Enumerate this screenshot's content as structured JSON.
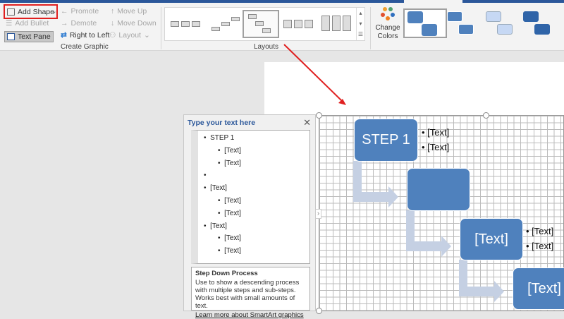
{
  "ribbon": {
    "add_shape": "Add Shape",
    "add_bullet": "Add Bullet",
    "text_pane": "Text Pane",
    "promote": "Promote",
    "demote": "Demote",
    "right_to_left": "Right to Left",
    "move_up": "Move Up",
    "move_down": "Move Down",
    "layout": "Layout",
    "group_create": "Create Graphic",
    "group_layouts": "Layouts",
    "change_colors": "Change Colors"
  },
  "text_pane": {
    "title": "Type your text here",
    "items": [
      {
        "level": 1,
        "text": "STEP 1"
      },
      {
        "level": 2,
        "text": "[Text]"
      },
      {
        "level": 2,
        "text": "[Text]"
      },
      {
        "level": 1,
        "text": ""
      },
      {
        "level": 1,
        "text": "[Text]"
      },
      {
        "level": 2,
        "text": "[Text]"
      },
      {
        "level": 2,
        "text": "[Text]"
      },
      {
        "level": 1,
        "text": "[Text]"
      },
      {
        "level": 2,
        "text": "[Text]"
      },
      {
        "level": 2,
        "text": "[Text]"
      }
    ],
    "desc_title": "Step Down Process",
    "desc_body": "Use to show a descending process with multiple steps and sub-steps. Works best with small amounts of text.",
    "learn_more": "Learn more about SmartArt graphics"
  },
  "diagram": {
    "step1": "STEP 1",
    "step2": "",
    "step3": "[Text]",
    "step4": "[Text]",
    "b1a": "[Text]",
    "b1b": "[Text]",
    "b3a": "[Text]",
    "b3b": "[Text]"
  },
  "colors": {
    "accent": "#4f81bd",
    "highlight": "#e02020"
  }
}
